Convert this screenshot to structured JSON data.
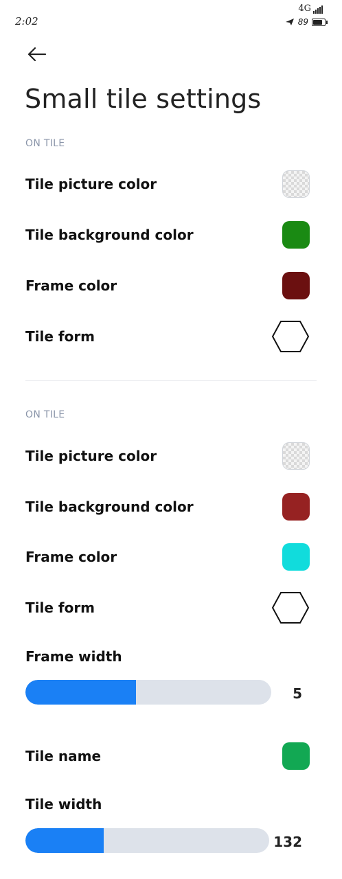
{
  "status_bar": {
    "time": "2:02",
    "network": "4G",
    "battery": "89"
  },
  "header": {
    "title": "Small tile settings"
  },
  "sections": [
    {
      "label": "ON TILE",
      "rows": [
        {
          "label": "Tile picture color",
          "color": "transparent"
        },
        {
          "label": "Tile background color",
          "color": "#1a8a13"
        },
        {
          "label": "Frame color",
          "color": "#6b1010"
        },
        {
          "label": "Tile form",
          "shape": "hexagon"
        }
      ]
    },
    {
      "label": "ON TILE",
      "rows": [
        {
          "label": "Tile picture color",
          "color": "transparent"
        },
        {
          "label": "Tile background color",
          "color": "#962222"
        },
        {
          "label": "Frame color",
          "color": "#11dcdc"
        },
        {
          "label": "Tile form",
          "shape": "hexagon"
        }
      ]
    }
  ],
  "frame_width": {
    "label": "Frame width",
    "value": "5",
    "fraction": 0.45
  },
  "tile_name": {
    "label": "Tile name",
    "color": "#12a853"
  },
  "tile_width": {
    "label": "Tile width",
    "value": "132",
    "fraction": 0.32
  },
  "colors": {
    "accent": "#1a80f5",
    "track": "#dde2ea",
    "section_label": "#8b96aa"
  }
}
